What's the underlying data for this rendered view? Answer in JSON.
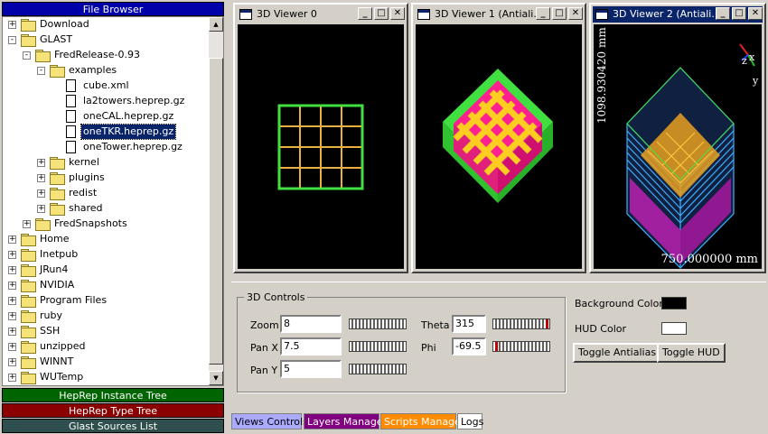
{
  "left_panel": {
    "title": "File Browser",
    "tree": [
      {
        "label": "Download",
        "level": 0,
        "type": "folder",
        "expander": "+"
      },
      {
        "label": "GLAST",
        "level": 0,
        "type": "folder",
        "expander": "-"
      },
      {
        "label": "FredRelease-0.93",
        "level": 1,
        "type": "folder",
        "expander": "-"
      },
      {
        "label": "examples",
        "level": 2,
        "type": "folder",
        "expander": "-"
      },
      {
        "label": "cube.xml",
        "level": 3,
        "type": "file"
      },
      {
        "label": "la2towers.heprep.gz",
        "level": 3,
        "type": "file"
      },
      {
        "label": "oneCAL.heprep.gz",
        "level": 3,
        "type": "file"
      },
      {
        "label": "oneTKR.heprep.gz",
        "level": 3,
        "type": "file",
        "selected": true
      },
      {
        "label": "oneTower.heprep.gz",
        "level": 3,
        "type": "file"
      },
      {
        "label": "kernel",
        "level": 2,
        "type": "folder",
        "expander": "+"
      },
      {
        "label": "plugins",
        "level": 2,
        "type": "folder",
        "expander": "+"
      },
      {
        "label": "redist",
        "level": 2,
        "type": "folder",
        "expander": "+"
      },
      {
        "label": "shared",
        "level": 2,
        "type": "folder",
        "expander": "+"
      },
      {
        "label": "FredSnapshots",
        "level": 1,
        "type": "folder",
        "expander": "+"
      },
      {
        "label": "Home",
        "level": 0,
        "type": "folder",
        "expander": "+"
      },
      {
        "label": "Inetpub",
        "level": 0,
        "type": "folder",
        "expander": "+"
      },
      {
        "label": "JRun4",
        "level": 0,
        "type": "folder",
        "expander": "+"
      },
      {
        "label": "NVIDIA",
        "level": 0,
        "type": "folder",
        "expander": "+"
      },
      {
        "label": "Program Files",
        "level": 0,
        "type": "folder",
        "expander": "+"
      },
      {
        "label": "ruby",
        "level": 0,
        "type": "folder",
        "expander": "+"
      },
      {
        "label": "SSH",
        "level": 0,
        "type": "folder",
        "expander": "+"
      },
      {
        "label": "unzipped",
        "level": 0,
        "type": "folder",
        "expander": "+"
      },
      {
        "label": "WINNT",
        "level": 0,
        "type": "folder",
        "expander": "+"
      },
      {
        "label": "WUTemp",
        "level": 0,
        "type": "folder",
        "expander": "+"
      }
    ],
    "bottom_panels": [
      "HepRep Instance Tree",
      "HepRep Type Tree",
      "Glast Sources List"
    ]
  },
  "viewers": [
    {
      "title": "3D Viewer 0"
    },
    {
      "title": "3D Viewer 1 (Antiali..."
    },
    {
      "title": "3D Viewer 2 (Antiali...",
      "hud_y": "1098.930420 mm",
      "hud_x": "750.000000 mm",
      "axes": {
        "x": "x",
        "y": "y",
        "z": "z"
      }
    }
  ],
  "window_buttons": {
    "minimize": "_",
    "maximize": "□",
    "close": "✕"
  },
  "controls": {
    "group_title": "3D Controls",
    "zoom": {
      "label": "Zoom",
      "value": "8"
    },
    "pan_x": {
      "label": "Pan X",
      "value": "7.5"
    },
    "pan_y": {
      "label": "Pan Y",
      "value": "5"
    },
    "theta": {
      "label": "Theta",
      "value": "315"
    },
    "phi": {
      "label": "Phi",
      "value": "-69.5"
    },
    "background_color": {
      "label": "Background Color",
      "color": "#000000"
    },
    "hud_color": {
      "label": "HUD Color",
      "color": "#ffffff"
    },
    "toggle_antialias": "Toggle Antialias",
    "toggle_hud": "Toggle HUD"
  },
  "tabs": [
    {
      "label": "Views Controls",
      "color": "#aaaaff",
      "active": true
    },
    {
      "label": "Layers Manager",
      "color": "#800080"
    },
    {
      "label": "Scripts Manager",
      "color": "#ff8c00"
    },
    {
      "label": "Logs",
      "color": "#ffffff"
    }
  ]
}
